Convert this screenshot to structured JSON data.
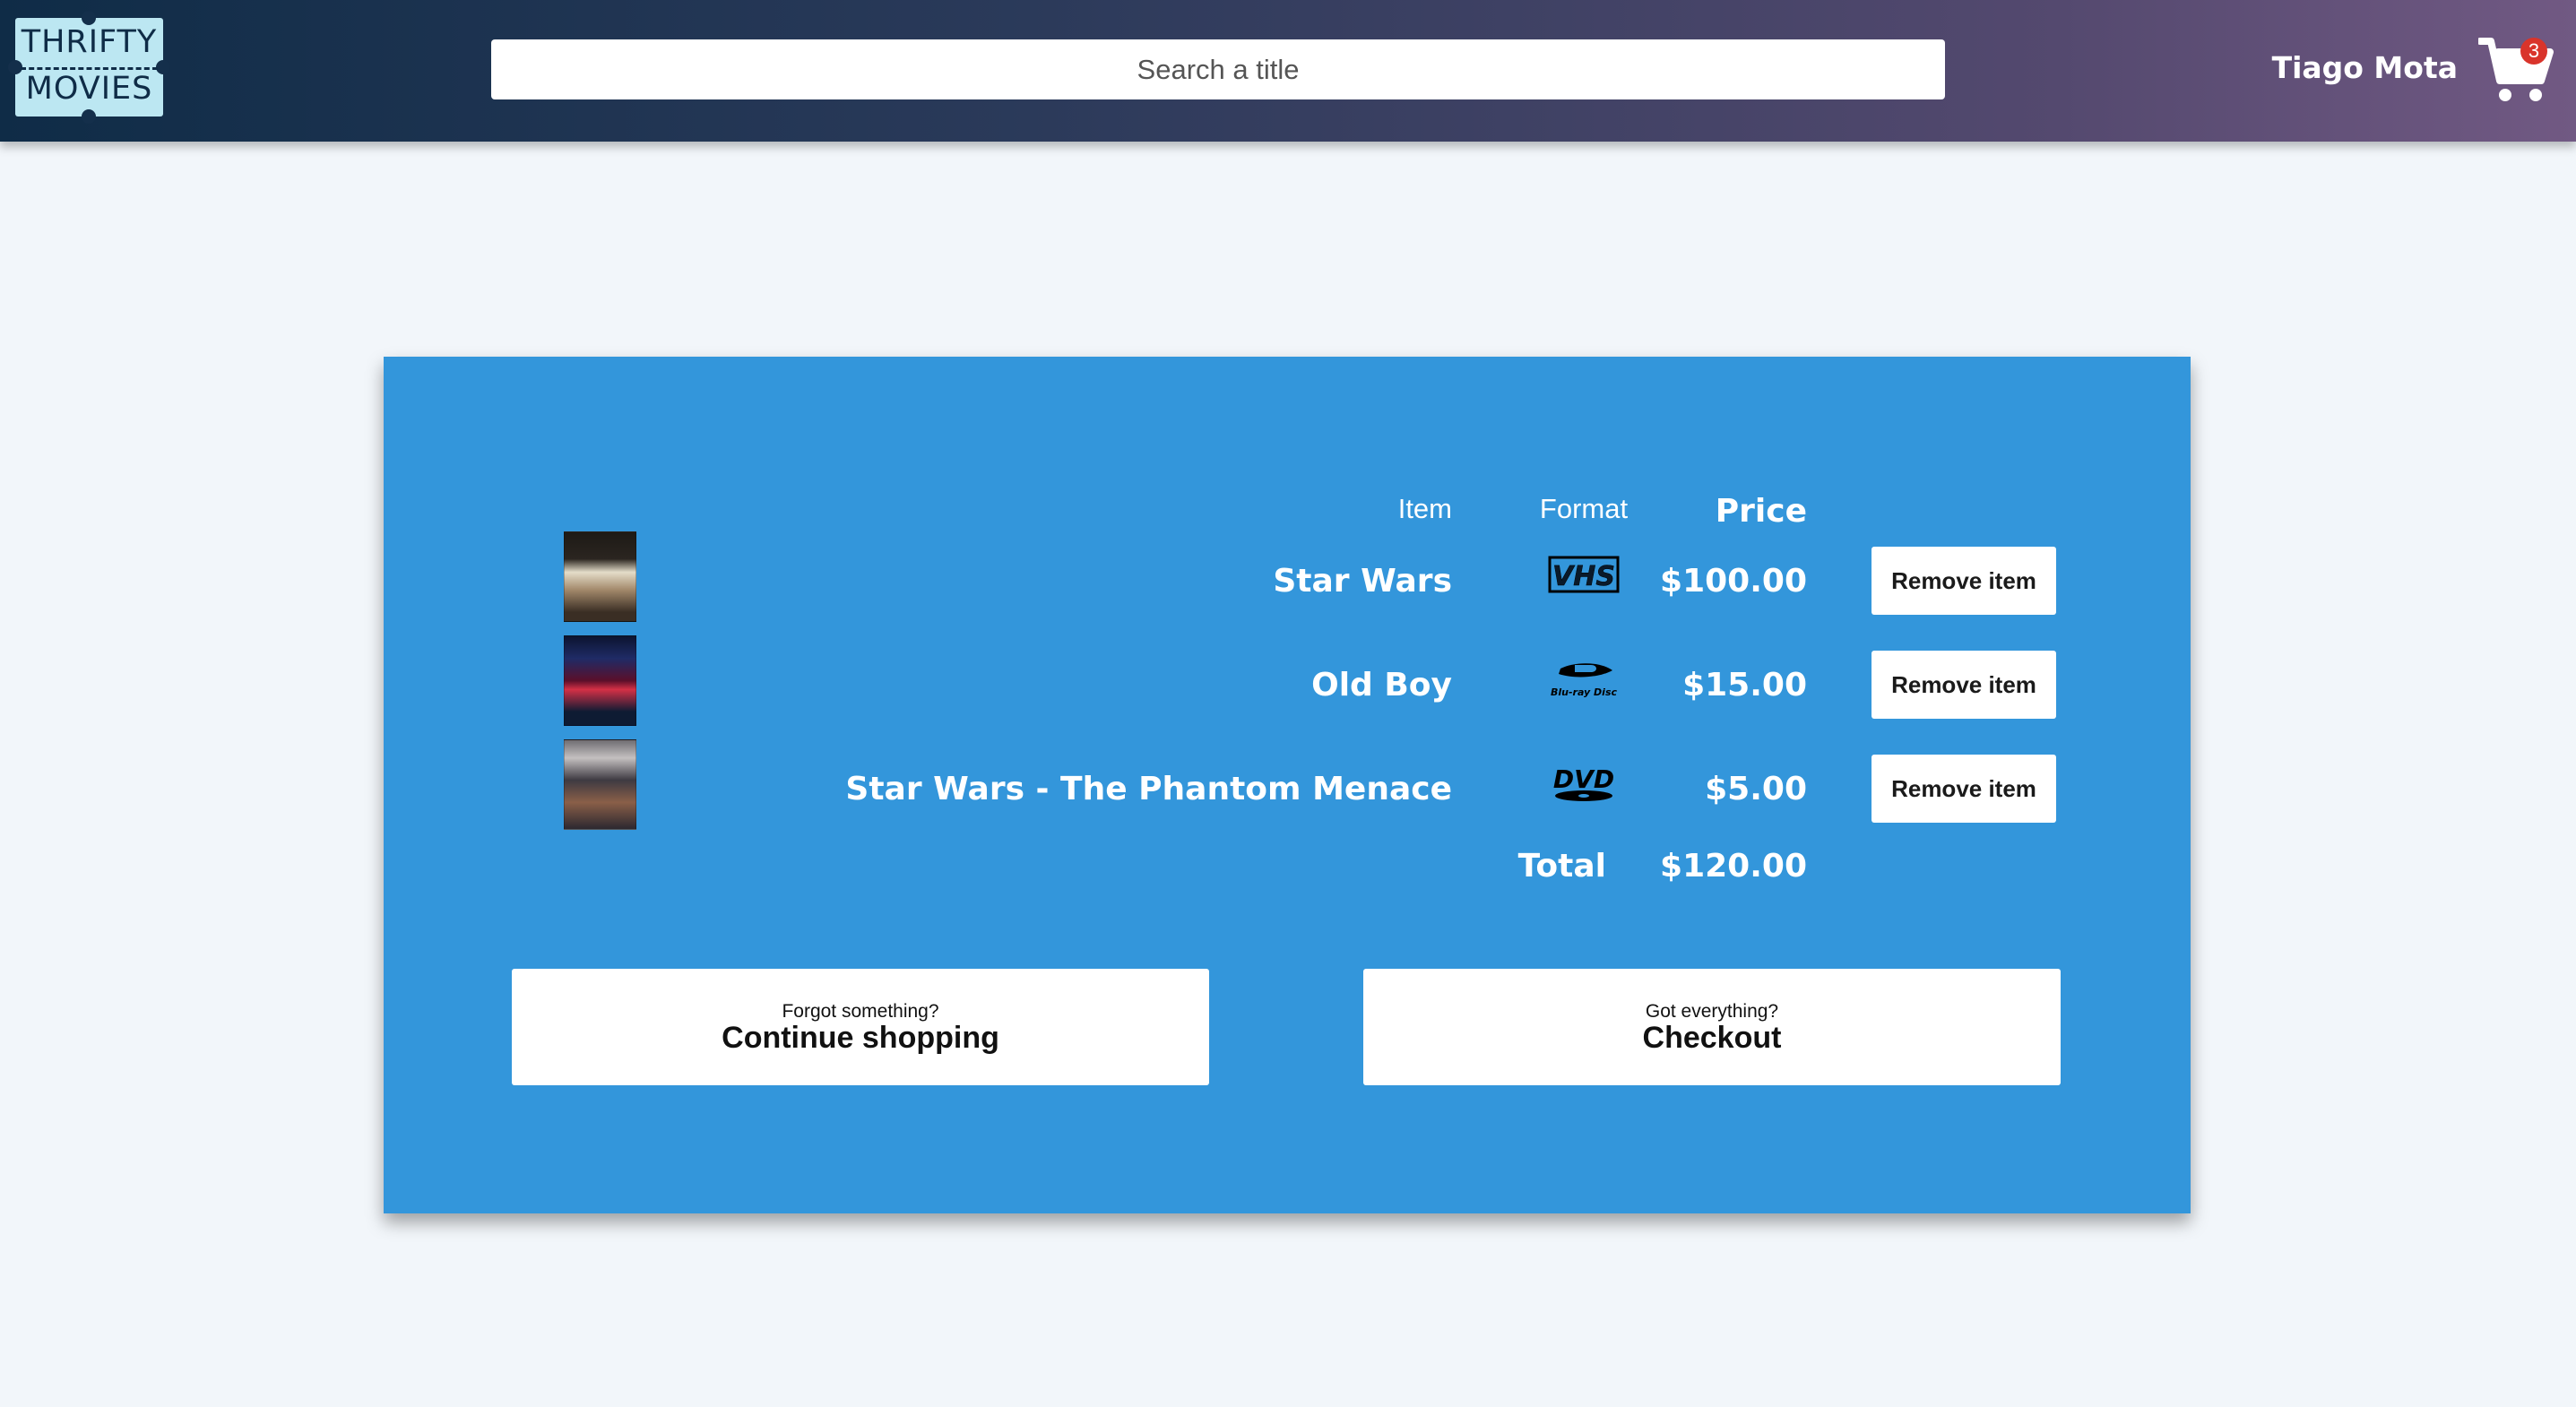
{
  "brand": {
    "logo_line_1": "THRIFTY",
    "logo_line_2": "MOVIES"
  },
  "header": {
    "search_placeholder": "Search a title",
    "user_name": "Tiago Mota",
    "cart_count": "3",
    "cart_icon": "shopping-cart-icon"
  },
  "cart": {
    "columns": {
      "item": "Item",
      "format": "Format",
      "price": "Price"
    },
    "items": [
      {
        "title": "Star Wars",
        "format": "VHS",
        "format_icon": "vhs-icon",
        "price": "$100.00",
        "remove_label": "Remove item"
      },
      {
        "title": "Old Boy",
        "format": "Blu-ray Disc",
        "format_icon": "bluray-icon",
        "price": "$15.00",
        "remove_label": "Remove item"
      },
      {
        "title": "Star Wars - The Phantom Menace",
        "format": "DVD",
        "format_icon": "dvd-icon",
        "price": "$5.00",
        "remove_label": "Remove item"
      }
    ],
    "total_label": "Total",
    "total_value": "$120.00"
  },
  "actions": {
    "continue": {
      "sub": "Forgot something?",
      "main": "Continue shopping"
    },
    "checkout": {
      "sub": "Got everything?",
      "main": "Checkout"
    }
  },
  "colors": {
    "panel": "#3396db",
    "background": "#f2f6fa",
    "header_start": "#0f2c47",
    "header_end": "#715983",
    "badge": "#d9342b",
    "logo": "#bce7f2"
  }
}
